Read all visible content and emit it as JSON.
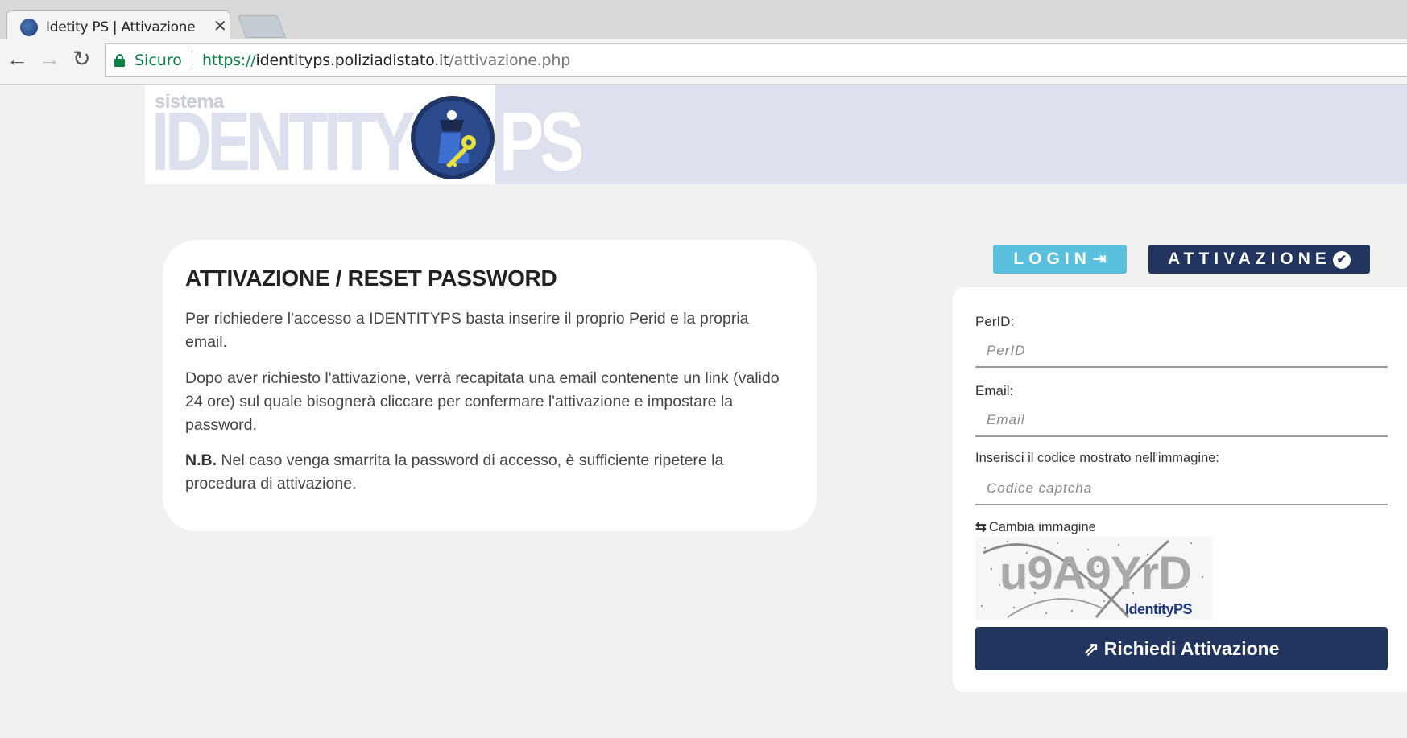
{
  "browser": {
    "tab_title": "Idetity PS | Attivazione",
    "tab_close": "✕",
    "secure_label": "Sicuro",
    "url_scheme": "https://",
    "url_host": "identityps.poliziadistato.it",
    "url_path": "/attivazione.php"
  },
  "header": {
    "logo_small": "sistema",
    "logo_main": "IDENTITY",
    "logo_suffix": "PS"
  },
  "info": {
    "title": "ATTIVAZIONE / RESET PASSWORD",
    "p1": "Per richiedere l'accesso a IDENTITYPS basta inserire il proprio Perid e la propria email.",
    "p2": "Dopo aver richiesto l'attivazione, verrà recapitata una email contenente un link (valido 24 ore) sul quale bisognerà cliccare per confermare l'attivazione e impostare la password.",
    "nb_label": "N.B.",
    "p3": " Nel caso venga smarrita la password di accesso, è sufficiente ripetere la procedura di attivazione."
  },
  "nav_buttons": {
    "login": "LOGIN",
    "attivazione": "ATTIVAZIONE"
  },
  "form": {
    "perid_label": "PerID:",
    "perid_placeholder": "PerID",
    "email_label": "Email:",
    "email_placeholder": "Email",
    "captcha_label": "Inserisci il codice mostrato nell'immagine:",
    "captcha_placeholder": "Codice captcha",
    "change_image": "Cambia immagine",
    "captcha_text": "u9A9YrD",
    "captcha_brand": "IdentityPS",
    "submit": "Richiedi Attivazione"
  },
  "colors": {
    "primary": "#22355f",
    "login_btn": "#5bc0de",
    "banner": "#dde1ed",
    "secure_green": "#0b8043"
  },
  "icons": {
    "tab_favicon": "globe-icon",
    "back": "arrow-left-icon",
    "forward": "arrow-right-icon",
    "reload": "reload-icon",
    "secure": "lock-icon",
    "login": "sign-in-icon",
    "attivazione": "check-circle-icon",
    "change_image": "refresh-icon",
    "submit": "external-link-icon"
  }
}
